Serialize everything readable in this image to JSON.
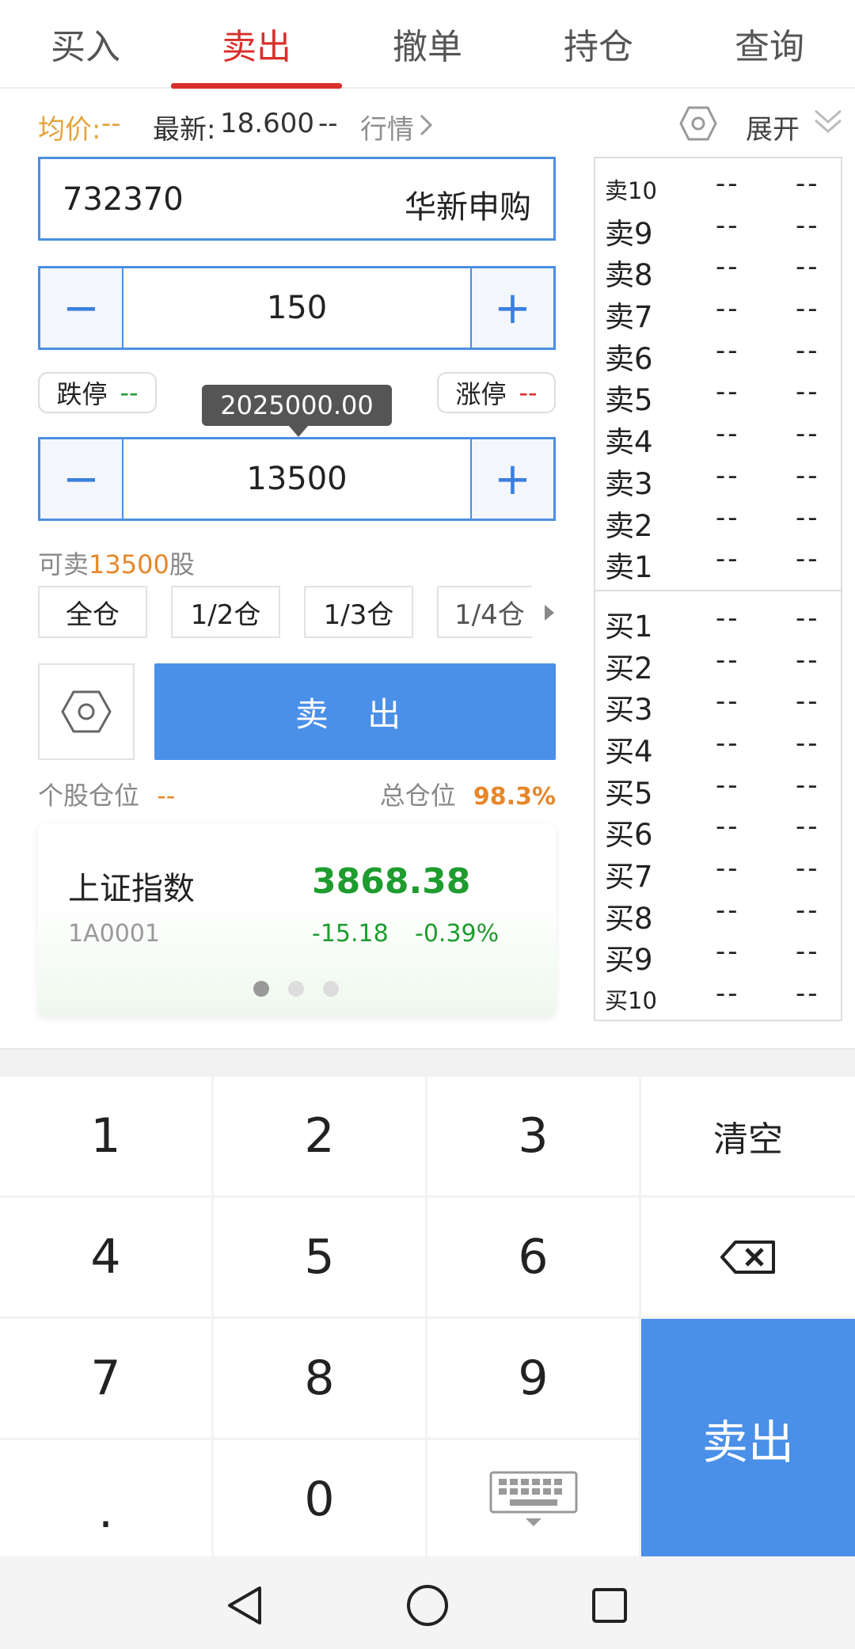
{
  "tabs": [
    {
      "label": "买入"
    },
    {
      "label": "卖出"
    },
    {
      "label": "撤单"
    },
    {
      "label": "持仓"
    },
    {
      "label": "查询"
    }
  ],
  "active_tab": "卖出",
  "info": {
    "avg_label": "均价:",
    "avg_value": "--",
    "latest_label": "最新:",
    "latest_value": "18.600",
    "latest_change": "--",
    "quote_link": "行情",
    "expand": "展开"
  },
  "stock": {
    "code": "732370",
    "name": "华新申购"
  },
  "price": {
    "value": "150",
    "minus": "−",
    "plus": "+"
  },
  "limits": {
    "down_label": "跌停",
    "down_value": "--",
    "up_label": "涨停",
    "up_value": "--"
  },
  "tooltip": "2025000.00",
  "quantity": {
    "value": "13500",
    "minus": "−",
    "plus": "+"
  },
  "sellable": {
    "prefix": "可卖",
    "amount": "13500",
    "suffix": "股"
  },
  "position_buttons": [
    {
      "label": "全仓"
    },
    {
      "label": "1/2仓"
    },
    {
      "label": "1/3仓"
    },
    {
      "label": "1/4仓"
    }
  ],
  "sell_button": "卖 出",
  "positions": {
    "single_label": "个股仓位",
    "single_value": "--",
    "total_label": "总仓位",
    "total_value": "98.3%"
  },
  "index_card": {
    "name": "上证指数",
    "code": "1A0001",
    "value": "3868.38",
    "change": "-15.18",
    "pct": "-0.39%"
  },
  "order_book": {
    "asks": [
      {
        "label": "卖10",
        "price": "--",
        "vol": "--"
      },
      {
        "label": "卖9",
        "price": "--",
        "vol": "--"
      },
      {
        "label": "卖8",
        "price": "--",
        "vol": "--"
      },
      {
        "label": "卖7",
        "price": "--",
        "vol": "--"
      },
      {
        "label": "卖6",
        "price": "--",
        "vol": "--"
      },
      {
        "label": "卖5",
        "price": "--",
        "vol": "--"
      },
      {
        "label": "卖4",
        "price": "--",
        "vol": "--"
      },
      {
        "label": "卖3",
        "price": "--",
        "vol": "--"
      },
      {
        "label": "卖2",
        "price": "--",
        "vol": "--"
      },
      {
        "label": "卖1",
        "price": "--",
        "vol": "--"
      }
    ],
    "bids": [
      {
        "label": "买1",
        "price": "--",
        "vol": "--"
      },
      {
        "label": "买2",
        "price": "--",
        "vol": "--"
      },
      {
        "label": "买3",
        "price": "--",
        "vol": "--"
      },
      {
        "label": "买4",
        "price": "--",
        "vol": "--"
      },
      {
        "label": "买5",
        "price": "--",
        "vol": "--"
      },
      {
        "label": "买6",
        "price": "--",
        "vol": "--"
      },
      {
        "label": "买7",
        "price": "--",
        "vol": "--"
      },
      {
        "label": "买8",
        "price": "--",
        "vol": "--"
      },
      {
        "label": "买9",
        "price": "--",
        "vol": "--"
      },
      {
        "label": "买10",
        "price": "--",
        "vol": "--"
      }
    ]
  },
  "keypad": {
    "k1": "1",
    "k2": "2",
    "k3": "3",
    "clear": "清空",
    "k4": "4",
    "k5": "5",
    "k6": "6",
    "k7": "7",
    "k8": "8",
    "k9": "9",
    "dot": ".",
    "k0": "0",
    "sell": "卖出"
  },
  "colors": {
    "accent": "#d9302c",
    "primary": "#4a8fe8",
    "orange": "#e6872a",
    "green": "#1e9c2e"
  }
}
